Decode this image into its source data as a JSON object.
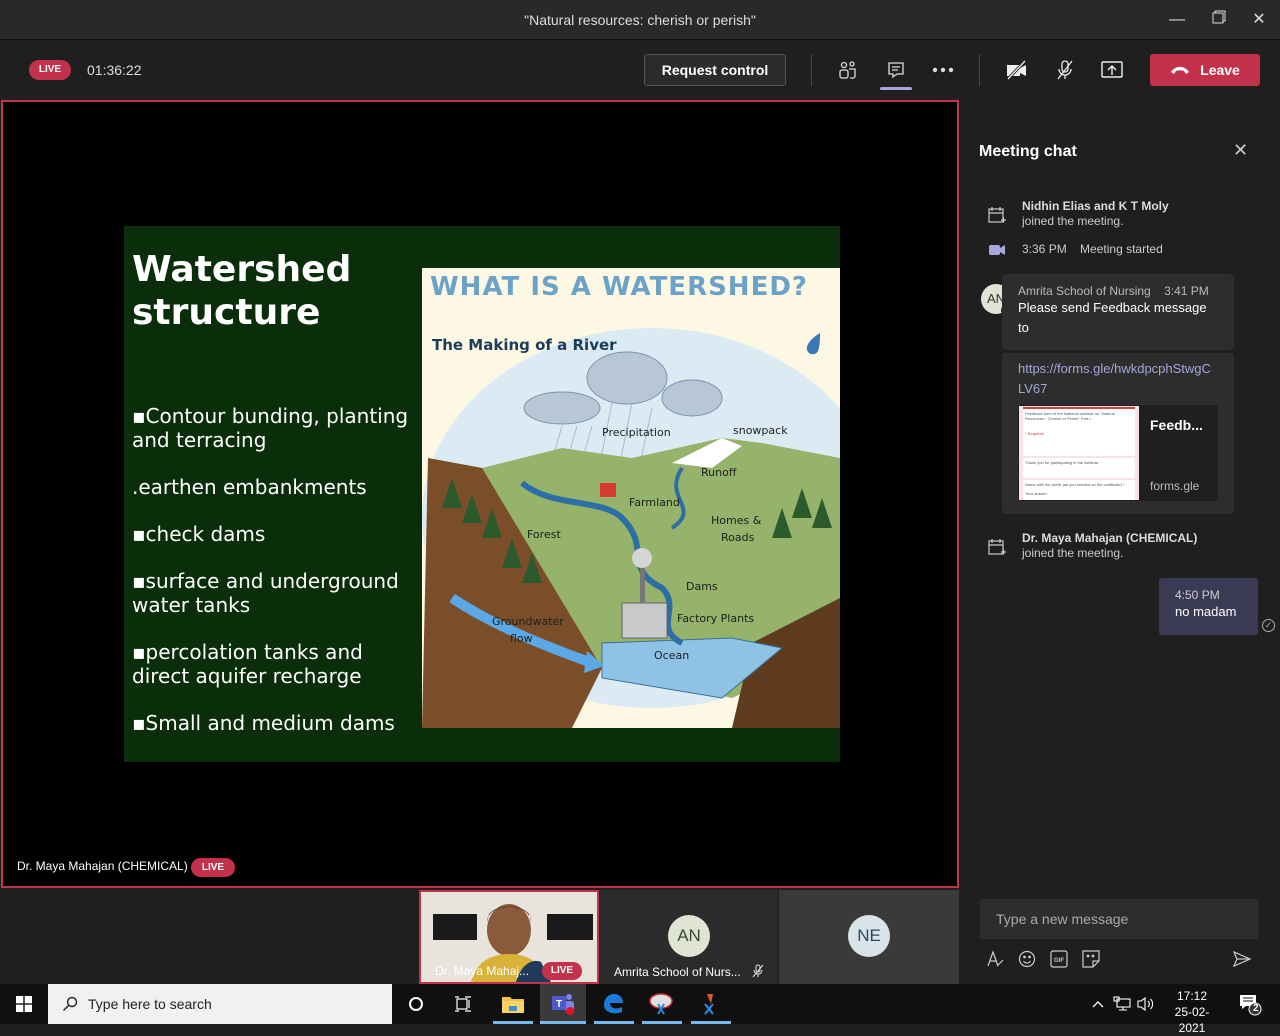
{
  "window": {
    "title": "\"Natural resources: cherish or perish\"",
    "minimize_icon": "minimize-icon",
    "maximize_icon": "restore-icon",
    "close_icon": "close-icon"
  },
  "toolbar": {
    "live_label": "LIVE",
    "elapsed": "01:36:22",
    "request_control_label": "Request control",
    "icons": [
      "participants-icon",
      "chat-icon",
      "more-icon",
      "camera-off-icon",
      "mic-off-icon",
      "share-screen-icon"
    ],
    "leave_label": "Leave",
    "accent_color": "#c4314b"
  },
  "stage": {
    "presenter_name": "Dr. Maya Mahajan (CHEMICAL)",
    "live_label": "LIVE",
    "slide": {
      "title_line1": "Watershed",
      "title_line2": "structure",
      "bullets": [
        "▪Contour bunding, planting and terracing",
        ".earthen embankments",
        "▪check dams",
        "▪surface and underground water tanks",
        "▪percolation tanks and direct aquifer recharge",
        "▪Small and medium dams"
      ],
      "diagram": {
        "title": "WHAT IS A WATERSHED?",
        "subtitle": "The Making of a River",
        "labels": {
          "precipitation": "Precipitation",
          "snowpack": "snowpack",
          "runoff": "Runoff",
          "farmland": "Farmland",
          "homes": "Homes &",
          "roads": "Roads",
          "forest": "Forest",
          "dams": "Dams",
          "groundwater": "Groundwater",
          "flow": "flow",
          "factory": "Factory Plants",
          "ocean": "Ocean"
        }
      }
    }
  },
  "chat": {
    "title": "Meeting chat",
    "events": [
      {
        "names": "Nidhin Elias and K T Moly",
        "action": "joined the meeting."
      },
      {
        "time": "3:36 PM",
        "action": "Meeting started"
      },
      {
        "names": "Dr. Maya Mahajan (CHEMICAL)",
        "action": "joined the meeting."
      }
    ],
    "message": {
      "avatar": "AN",
      "sender": "Amrita School of Nursing",
      "time": "3:41 PM",
      "text": "Please send Feedback message to",
      "link": "https://forms.gle/hwkdpcphStwgCLV67",
      "card": {
        "title": "Feedb...",
        "domain": "forms.gle",
        "preview_heading": "Feedback form of the National webinar on \"Natural Resources : Cherish or Perish\" Part-I",
        "preview_required": "* Required",
        "preview_body": "Thank you for participating in the webinar.",
        "preview_question": "Name with the prefix (as you needed on the certificate) *",
        "preview_answer": "Your answer"
      }
    },
    "my_message": {
      "time": "4:50 PM",
      "text": "no madam"
    },
    "compose_placeholder": "Type a new message",
    "compose_tools": [
      "format-icon",
      "emoji-icon",
      "gif-icon",
      "sticker-icon"
    ],
    "send_icon": "send-icon"
  },
  "participants": [
    {
      "name": "Dr. Maya Mahaj...",
      "live_label": "LIVE",
      "type": "video"
    },
    {
      "name": "Amrita School of Nurs...",
      "avatar": "AN",
      "muted": true
    },
    {
      "avatar": "NE"
    }
  ],
  "taskbar": {
    "search_placeholder": "Type here to search",
    "time": "17:12",
    "date": "25-02-2021",
    "notification_count": "2"
  }
}
